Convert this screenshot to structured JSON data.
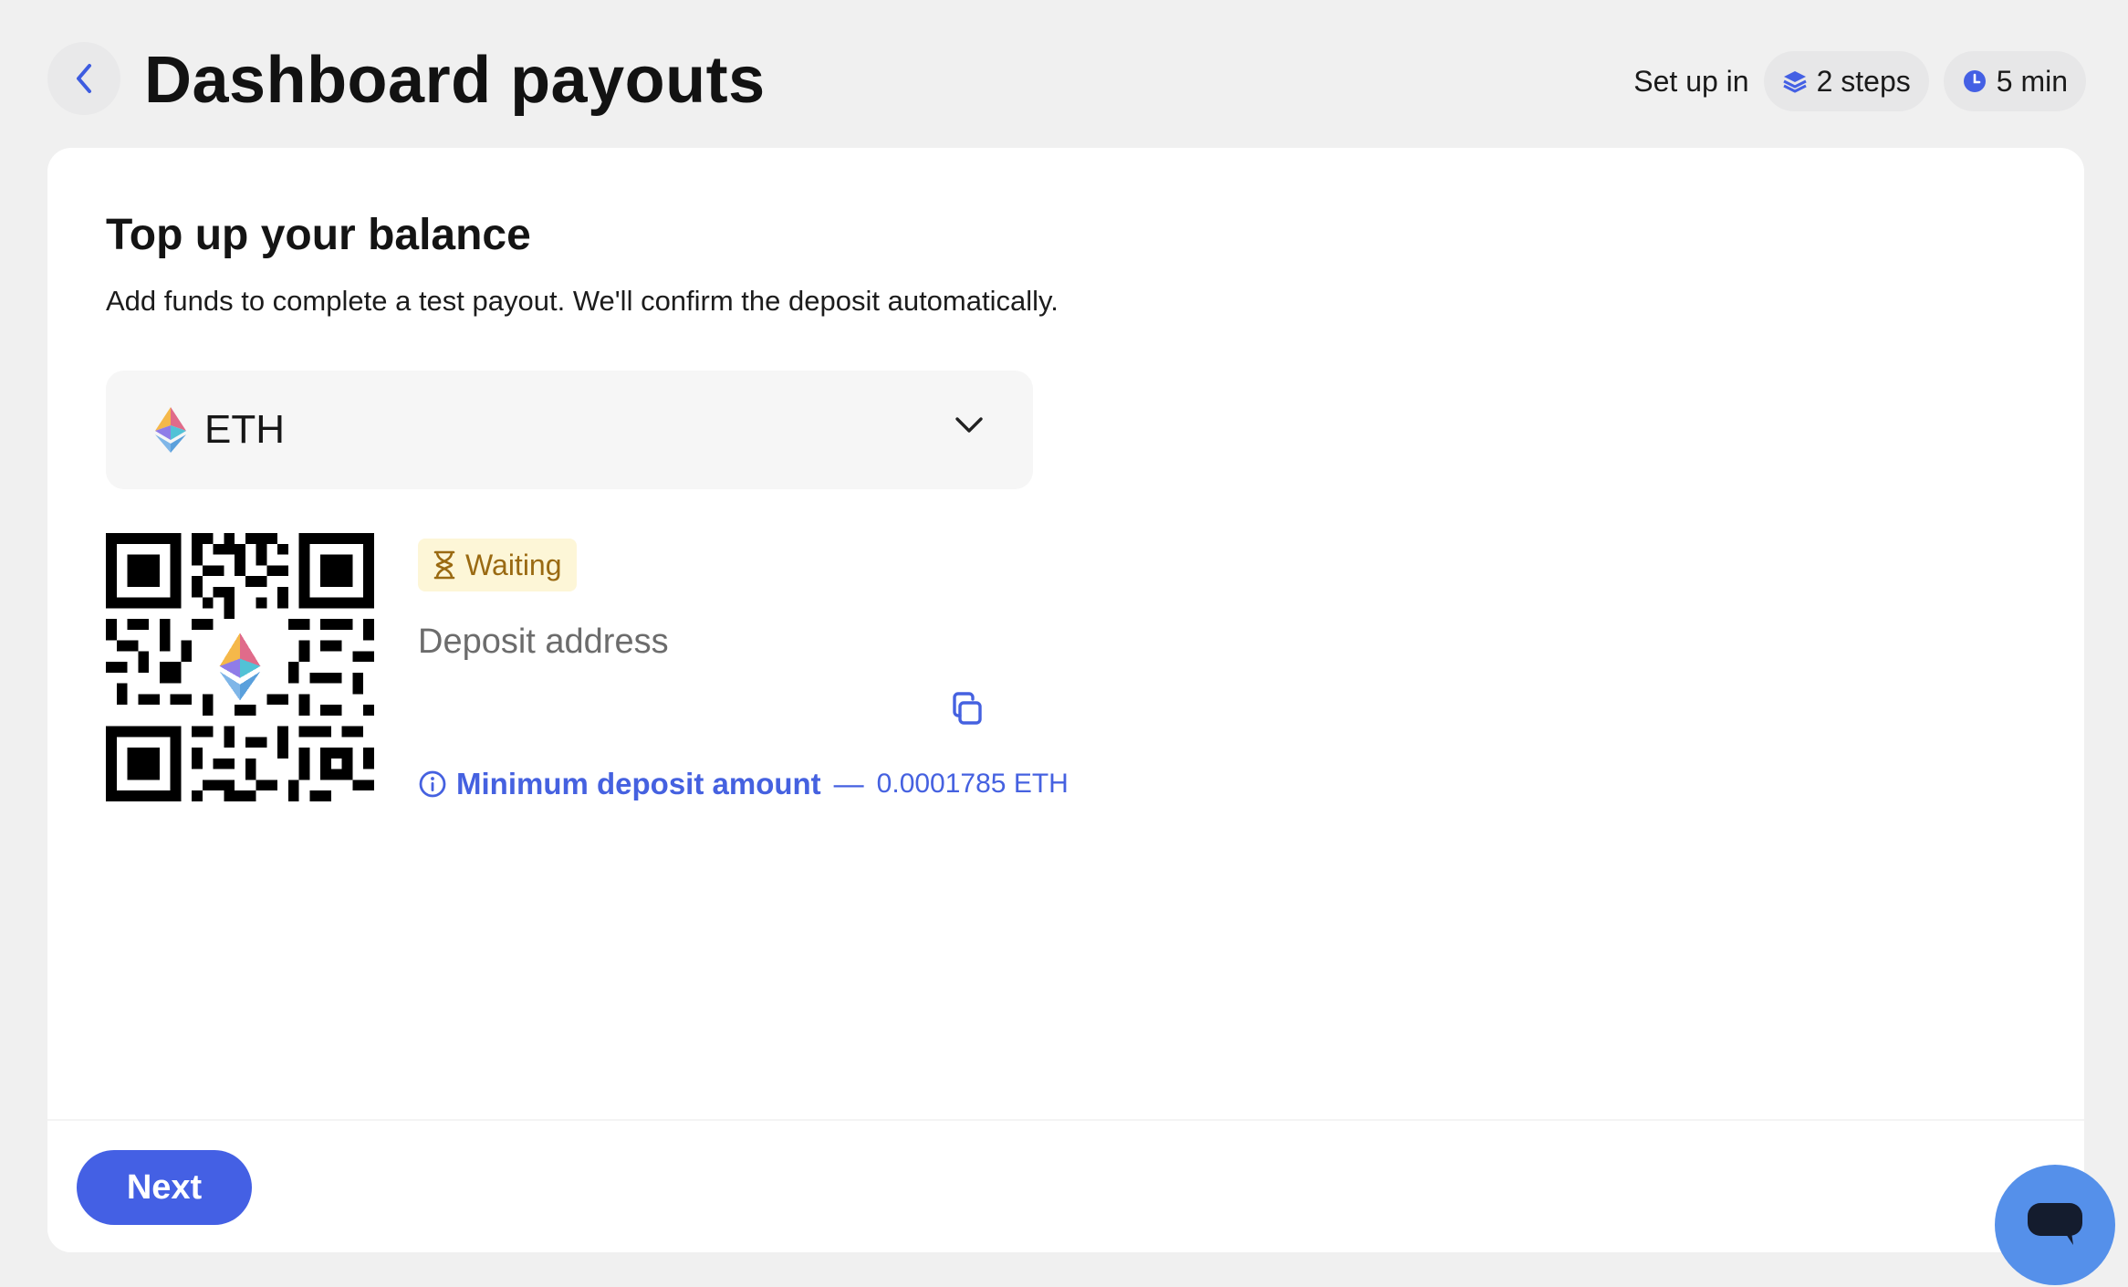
{
  "header": {
    "title": "Dashboard payouts",
    "setup_label": "Set up in",
    "steps_label": "2 steps",
    "time_label": "5 min"
  },
  "section": {
    "title": "Top up your balance",
    "description": "Add funds to complete a test payout. We'll confirm the deposit automatically."
  },
  "currency": {
    "selected": "ETH",
    "icon": "ethereum-icon"
  },
  "deposit": {
    "status": "Waiting",
    "address_label": "Deposit address",
    "min_label": "Minimum deposit amount",
    "min_separator": "—",
    "min_value": "0.0001785 ETH"
  },
  "footer": {
    "next_label": "Next"
  },
  "icons": {
    "back": "chevron-left-icon",
    "steps": "layers-icon",
    "time": "clock-icon",
    "dropdown": "chevron-down-icon",
    "status": "hourglass-icon",
    "copy": "copy-icon",
    "info": "info-icon",
    "chat": "chat-icon"
  },
  "colors": {
    "accent": "#4460e4",
    "waiting_text": "#9a6a12",
    "waiting_bg": "#fdf6d7",
    "chat": "#5590ea"
  }
}
